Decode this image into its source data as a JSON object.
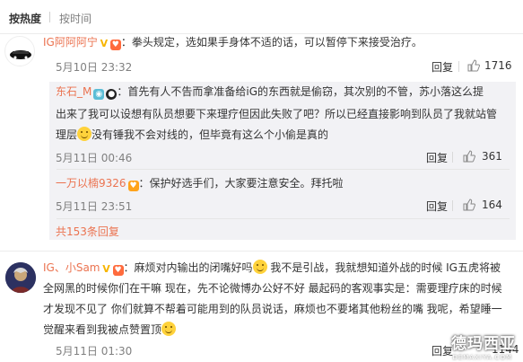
{
  "sortbar": {
    "hot": "按热度",
    "time": "按时间"
  },
  "comments": [
    {
      "user": "IG阿阿阿宁",
      "text": "：拳头规定，选如果手身体不适的话，可以暂停下来接受治疗。",
      "time": "5月10日 23:32",
      "reply_label": "回复",
      "likes": "1716",
      "replies": [
        {
          "user": "东石_M",
          "text_lines": [
            "：首先有人不告而拿准备给iG的东西就是偷窃，其次别的不管，苏小落这么提",
            "出来了我可以设想有队员想要下来理疗但因此失败了吧？所以已经直接影响到队员了我就站管",
            "没有锤我不会对线的，但毕竟有这么个小偷是真的"
          ],
          "line3_prefix": "理层",
          "time": "5月11日 00:46",
          "reply_label": "回复",
          "likes": "361"
        },
        {
          "user": "一万以楠9326",
          "text": "：保护好选手们，大家要注意安全。拜托啦",
          "time": "5月11日 23:51",
          "reply_label": "回复",
          "likes": "164"
        }
      ],
      "more_label": "共153条回复"
    },
    {
      "user": "IG、小Sam",
      "text_lines": [
        "：麻烦对内输出的闭嘴好吗",
        " 我不是引战，我就想知道外战的时候 IG五虎将被",
        "全网黑的时候你们在干嘛 现在，先不论微博办公好不好 最起码的客观事实是：需要理疗床的时候",
        "才发现不见了 你们就算不帮着可能用到的队员说话，麻烦也不要堵其他粉丝的嘴 我呢，希望睡一",
        "觉醒来看到我被点赞置顶"
      ],
      "time": "5月11日 01:30",
      "reply_label": "回复",
      "likes": "1144"
    }
  ],
  "watermark": {
    "main": "德玛西亚",
    "sub": "DEMAXIYA.COM"
  },
  "colors": {
    "username": "#eb7350",
    "time": "#808080",
    "reply_bg": "#f2f2f5"
  }
}
